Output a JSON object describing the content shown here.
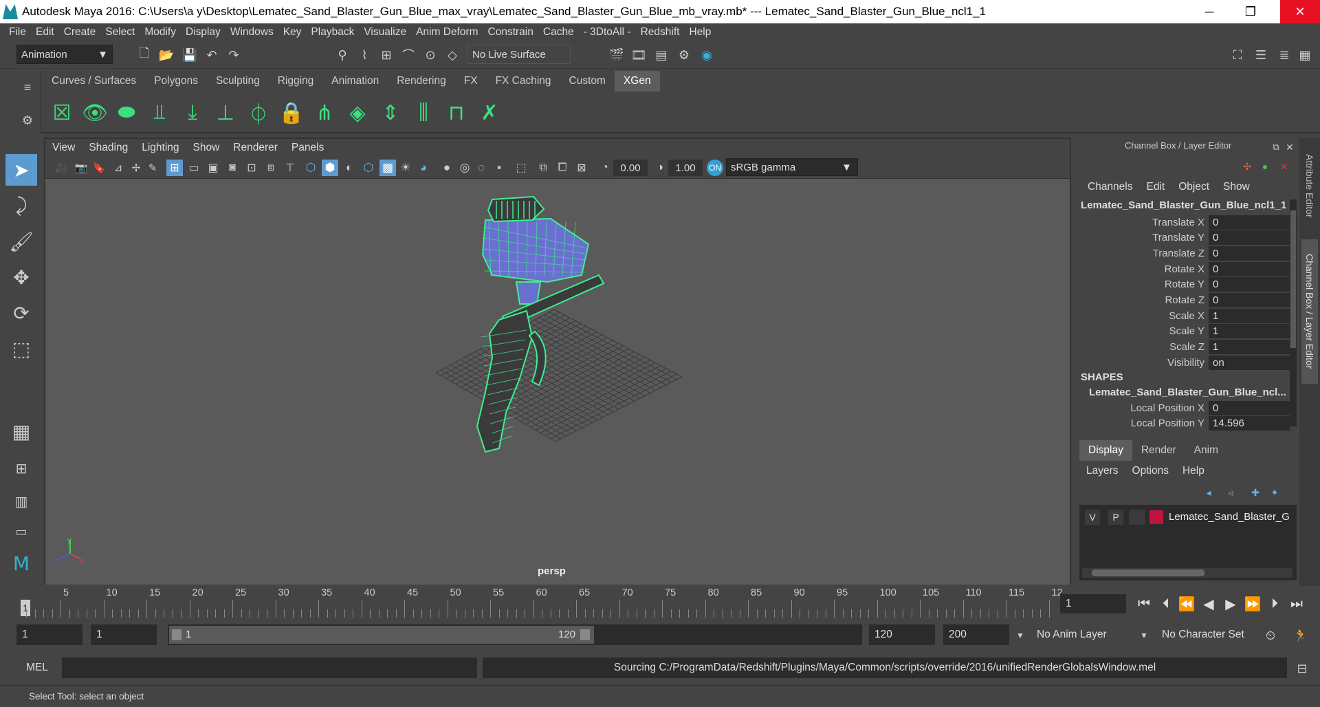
{
  "window": {
    "title": "Autodesk Maya 2016: C:\\Users\\a y\\Desktop\\Lematec_Sand_Blaster_Gun_Blue_max_vray\\Lematec_Sand_Blaster_Gun_Blue_mb_vray.mb*   ---   Lematec_Sand_Blaster_Gun_Blue_ncl1_1",
    "minimize": "─",
    "restore": "❐",
    "close": "✕",
    "accent": "#e81123"
  },
  "menubar": [
    "File",
    "Edit",
    "Create",
    "Select",
    "Modify",
    "Display",
    "Windows",
    "Key",
    "Playback",
    "Visualize",
    "Anim Deform",
    "Constrain",
    "Cache",
    "- 3DtoAll -",
    "Redshift",
    "Help"
  ],
  "statusline": {
    "mode": "Animation",
    "live_surface": "No Live Surface"
  },
  "shelf": {
    "tabs": [
      "Curves / Surfaces",
      "Polygons",
      "Sculpting",
      "Rigging",
      "Animation",
      "Rendering",
      "FX",
      "FX Caching",
      "Custom",
      "XGen"
    ],
    "active_tab": "XGen",
    "icon_color": "#3de07f"
  },
  "panel": {
    "menus": [
      "View",
      "Shading",
      "Lighting",
      "Show",
      "Renderer",
      "Panels"
    ],
    "exposure": "0.00",
    "gamma": "1.00",
    "color_space": "sRGB gamma",
    "camera_label": "persp",
    "wire_color": "#3cf08f"
  },
  "channel_box": {
    "header": "Channel Box / Layer Editor",
    "menus": [
      "Channels",
      "Edit",
      "Object",
      "Show"
    ],
    "object_name": "Lematec_Sand_Blaster_Gun_Blue_ncl1_1",
    "attributes": [
      {
        "label": "Translate X",
        "value": "0"
      },
      {
        "label": "Translate Y",
        "value": "0"
      },
      {
        "label": "Translate Z",
        "value": "0"
      },
      {
        "label": "Rotate X",
        "value": "0"
      },
      {
        "label": "Rotate Y",
        "value": "0"
      },
      {
        "label": "Rotate Z",
        "value": "0"
      },
      {
        "label": "Scale X",
        "value": "1"
      },
      {
        "label": "Scale Y",
        "value": "1"
      },
      {
        "label": "Scale Z",
        "value": "1"
      },
      {
        "label": "Visibility",
        "value": "on"
      }
    ],
    "shapes_header": "SHAPES",
    "shape_name": "Lematec_Sand_Blaster_Gun_Blue_ncl...",
    "shape_attributes": [
      {
        "label": "Local Position X",
        "value": "0"
      },
      {
        "label": "Local Position Y",
        "value": "14.596"
      }
    ]
  },
  "layer_editor": {
    "tabs": [
      "Display",
      "Render",
      "Anim"
    ],
    "active_tab": "Display",
    "menus": [
      "Layers",
      "Options",
      "Help"
    ],
    "layer": {
      "v": "V",
      "p": "P",
      "name": "Lematec_Sand_Blaster_G",
      "color": "#c0143c"
    }
  },
  "side_tabs": [
    "Attribute Editor",
    "Channel Box / Layer Editor"
  ],
  "timeline": {
    "ticks": [
      "5",
      "10",
      "15",
      "20",
      "25",
      "30",
      "35",
      "40",
      "45",
      "50",
      "55",
      "60",
      "65",
      "70",
      "75",
      "80",
      "85",
      "90",
      "95",
      "100",
      "105",
      "110",
      "115",
      "12"
    ],
    "current_frame": "1",
    "current_field": "1"
  },
  "range": {
    "start": "1",
    "playback_start": "1",
    "slider_start": "1",
    "slider_end": "120",
    "playback_end": "120",
    "end": "200",
    "anim_layer": "No Anim Layer",
    "character_set": "No Character Set"
  },
  "command": {
    "lang": "MEL",
    "result": "Sourcing C:/ProgramData/Redshift/Plugins/Maya/Common/scripts/override/2016/unifiedRenderGlobalsWindow.mel"
  },
  "help_line": "Select Tool: select an object"
}
